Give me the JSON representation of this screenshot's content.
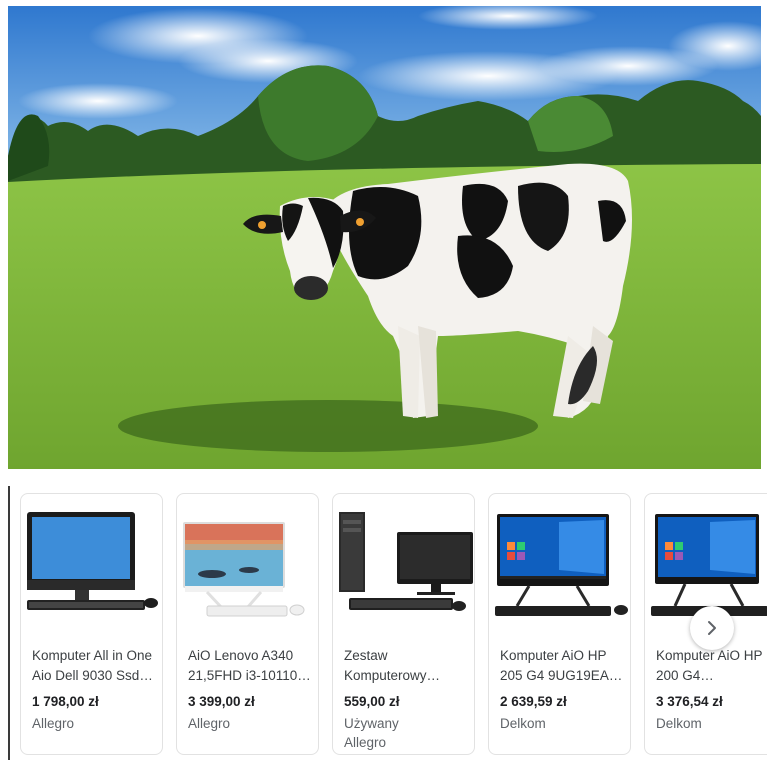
{
  "photo": {
    "subject": "cow-in-meadow"
  },
  "carousel": {
    "next_icon": "chevron-right-icon",
    "products": [
      {
        "title1": "Komputer All in One",
        "title2": "Aio Dell 9030 Ssd…",
        "price": "1 798,00 zł",
        "seller1": "Allegro",
        "seller2": ""
      },
      {
        "title1": "AiO Lenovo A340",
        "title2": "21,5FHD i3-10110…",
        "price": "3 399,00 zł",
        "seller1": "Allegro",
        "seller2": ""
      },
      {
        "title1": "Zestaw",
        "title2": "Komputerowy…",
        "price": "559,00 zł",
        "seller1": "Używany",
        "seller2": "Allegro"
      },
      {
        "title1": "Komputer AiO HP",
        "title2": "205 G4 9UG19EA…",
        "price": "2 639,59 zł",
        "seller1": "Delkom",
        "seller2": ""
      },
      {
        "title1": "Komputer AiO HP",
        "title2": "200 G4…",
        "price": "3 376,54 zł",
        "seller1": "Delkom",
        "seller2": ""
      }
    ]
  },
  "colors": {
    "sky": "#3d86d6",
    "grass": "#7bb83a",
    "text": "#3c4043",
    "muted": "#5f6368"
  }
}
